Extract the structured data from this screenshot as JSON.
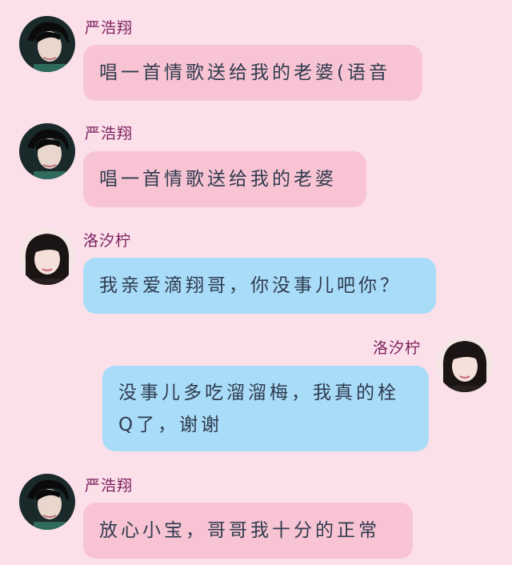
{
  "messages": [
    {
      "sender": "严浩翔",
      "avatar": "male-avatar",
      "side": "left",
      "text": "唱一首情歌送给我的老婆(语音",
      "bubble_color": "#f8c4d3"
    },
    {
      "sender": "严浩翔",
      "avatar": "male-avatar",
      "side": "left",
      "text": "唱一首情歌送给我的老婆",
      "bubble_color": "#f8c4d3"
    },
    {
      "sender": "洛汐柠",
      "avatar": "female-avatar",
      "side": "left",
      "text": "我亲爱滴翔哥，你没事儿吧你？",
      "bubble_color": "#a9dcf8"
    },
    {
      "sender": "洛汐柠",
      "avatar": "female-avatar",
      "side": "right",
      "text": "没事儿多吃溜溜梅，我真的栓Q了，谢谢",
      "bubble_color": "#a9dcf8"
    },
    {
      "sender": "严浩翔",
      "avatar": "male-avatar",
      "side": "left",
      "text": "放心小宝，哥哥我十分的正常",
      "bubble_color": "#f8c4d3"
    }
  ],
  "colors": {
    "background": "#fbe0ea",
    "name": "#7a1f5c",
    "text": "#2f3b4f"
  }
}
